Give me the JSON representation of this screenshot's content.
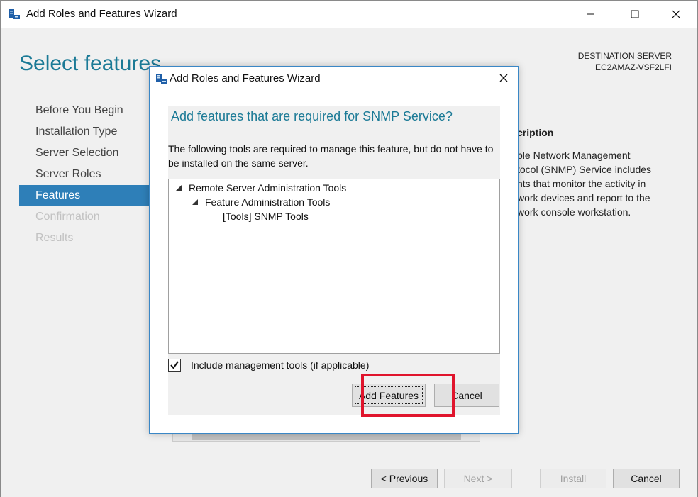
{
  "window": {
    "title": "Add Roles and Features Wizard",
    "controls": {
      "minimize": "minimize-icon",
      "maximize": "maximize-icon",
      "close": "close-icon"
    }
  },
  "page": {
    "title": "Select features",
    "destination_label": "DESTINATION SERVER",
    "destination_server": "EC2AMAZ-VSF2LFI"
  },
  "nav": {
    "items": [
      {
        "label": "Before You Begin",
        "state": "normal"
      },
      {
        "label": "Installation Type",
        "state": "normal"
      },
      {
        "label": "Server Selection",
        "state": "normal"
      },
      {
        "label": "Server Roles",
        "state": "normal"
      },
      {
        "label": "Features",
        "state": "active"
      },
      {
        "label": "Confirmation",
        "state": "disabled"
      },
      {
        "label": "Results",
        "state": "disabled"
      }
    ]
  },
  "description": {
    "heading": "cription",
    "lines": [
      "ple Network Management",
      "tocol (SNMP) Service includes",
      "nts that monitor the activity in",
      "work devices and report to the",
      "work console workstation."
    ]
  },
  "footer": {
    "previous": "< Previous",
    "next": "Next >",
    "install": "Install",
    "cancel": "Cancel"
  },
  "dialog": {
    "title": "Add Roles and Features Wizard",
    "heading": "Add features that are required for SNMP Service?",
    "text": "The following tools are required to manage this feature, but do not have to be installed on the same server.",
    "tree": [
      {
        "label": "Remote Server Administration Tools",
        "level": 0,
        "expanded": true
      },
      {
        "label": "Feature Administration Tools",
        "level": 1,
        "expanded": true
      },
      {
        "label": "[Tools] SNMP Tools",
        "level": 2,
        "expanded": false
      }
    ],
    "include_tools_label": "Include management tools (if applicable)",
    "include_tools_checked": true,
    "add_features": "Add Features",
    "cancel": "Cancel"
  },
  "colors": {
    "accent": "#1b7a96",
    "nav_active": "#2e7fb8",
    "highlight": "#e0142c",
    "dialog_border": "#3a87c6"
  }
}
